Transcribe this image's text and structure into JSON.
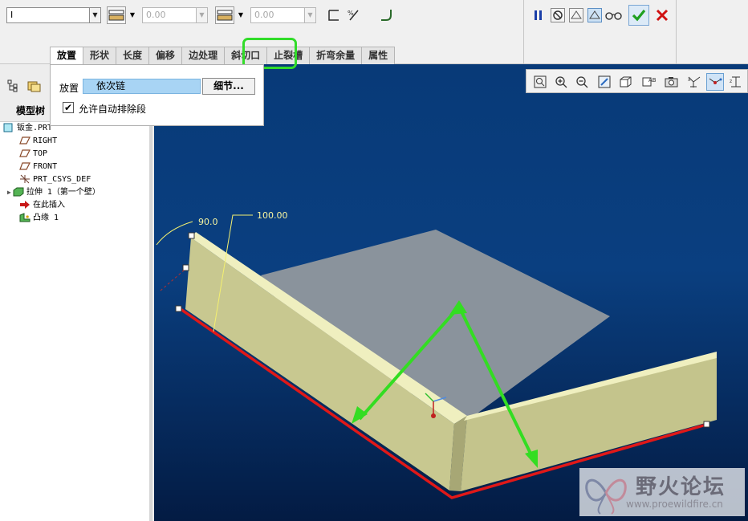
{
  "dashboard": {
    "type_combo_value": "I",
    "thickness1_value": "0.00",
    "thickness2_value": "0.00"
  },
  "tabs": [
    {
      "label": "放置",
      "active": true
    },
    {
      "label": "形状"
    },
    {
      "label": "长度"
    },
    {
      "label": "偏移"
    },
    {
      "label": "边处理"
    },
    {
      "label": "斜切口"
    },
    {
      "label": "止裂槽"
    },
    {
      "label": "折弯余量"
    },
    {
      "label": "属性"
    }
  ],
  "placement_panel": {
    "label": "放置",
    "chain_value": "依次链",
    "details_button": "细节...",
    "checkbox_label": "允许自动排除段",
    "checkbox_checked": true
  },
  "model_tree": {
    "title": "模型树",
    "nodes": [
      {
        "label": "钣金.PRT",
        "icon": "part-icon"
      },
      {
        "label": "RIGHT",
        "icon": "datum-plane-icon"
      },
      {
        "label": "TOP",
        "icon": "datum-plane-icon"
      },
      {
        "label": "FRONT",
        "icon": "datum-plane-icon"
      },
      {
        "label": "PRT_CSYS_DEF",
        "icon": "csys-icon"
      },
      {
        "label": "拉伸 1（第一个壁）",
        "icon": "extrude-icon"
      },
      {
        "label": "在此插入",
        "icon": "insert-here-arrow-icon"
      },
      {
        "label": "凸缘 1",
        "icon": "flange-icon"
      }
    ]
  },
  "viewport": {
    "angle_dim": "90.0",
    "length_dim": "100.00"
  },
  "watermark": {
    "title": "野火论坛",
    "url": "www.proewildfire.cn"
  },
  "colors": {
    "bg_top": "#083a78",
    "bg_bottom": "#031b43",
    "wall": "#c8c890",
    "base": "#8a939c",
    "edge_highlight": "#e01818",
    "annotation": "#33dd22",
    "ok": "#1fa01f",
    "cancel": "#d01010"
  }
}
